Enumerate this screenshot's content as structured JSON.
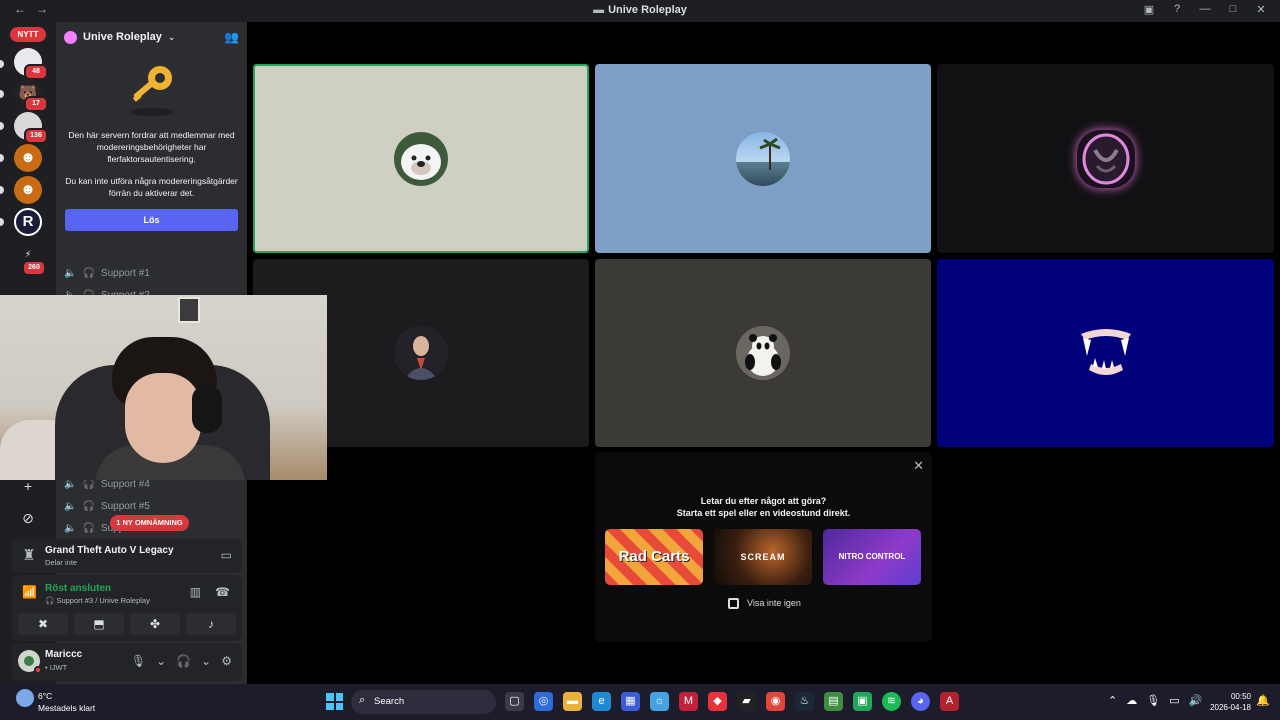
{
  "window": {
    "title": "Unive Roleplay",
    "back": "←",
    "forward": "→"
  },
  "rail": {
    "new_badge": "NYTT",
    "servers": [
      {
        "badge": "48"
      },
      {
        "badge": "17"
      },
      {
        "badge": "136"
      },
      {
        "badge": ""
      },
      {
        "badge": ""
      },
      {
        "badge": ""
      },
      {
        "badge": ""
      },
      {
        "badge": "260"
      }
    ],
    "add_glyph": "+",
    "explore_glyph": "⊘"
  },
  "server": {
    "name": "Unive Roleplay",
    "mfa_text_1": "Den här servern fordrar att medlemmar med modereringsbehörigheter har flerfaktorsautentisering.",
    "mfa_text_2": "Du kan inte utföra några modereringsåtgärder förrän du aktiverar det.",
    "resolve_button": "Lös",
    "channels_top": [
      {
        "label": "Support #1"
      },
      {
        "label": "Support #2"
      }
    ],
    "channels_bottom": [
      {
        "label": "Support #4"
      },
      {
        "label": "Support #5"
      },
      {
        "label": "Support #6"
      }
    ],
    "mention_pill": "1 NY OMNÄMNING"
  },
  "game_activity": {
    "title": "Grand Theft Auto V Legacy",
    "subtitle": "Delar inte"
  },
  "voice": {
    "status": "Röst ansluten",
    "location": "Support #3 / Unive Roleplay"
  },
  "user": {
    "name": "Mariccc",
    "status": "• IJWT"
  },
  "activity_card": {
    "line1": "Letar du efter något att göra?",
    "line2": "Starta ett spel eller en videostund direkt.",
    "games": [
      "Rad Carts",
      "SCREAM",
      "NITRO CONTROL"
    ],
    "checkbox_label": "Visa inte igen"
  },
  "taskbar": {
    "temperature": "6°C",
    "weather_text": "Mestadels klart",
    "search_placeholder": "Search",
    "time": "00:50",
    "date": "2026-04-18"
  },
  "colors": {
    "accent": "#5865f2",
    "danger": "#da373c",
    "online": "#23a55a"
  }
}
